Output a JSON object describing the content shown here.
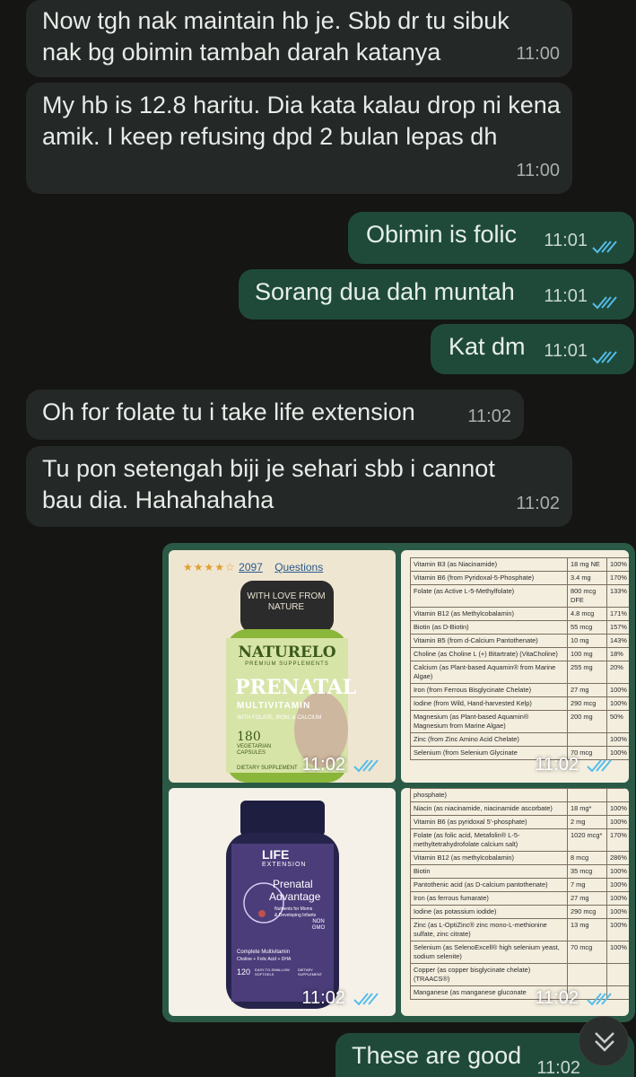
{
  "messages": [
    {
      "text": "Now tgh nak maintain hb je. Sbb dr tu sibuk nak bg obimin tambah darah katanya",
      "time": "11:00"
    },
    {
      "text": "My hb is 12.8 haritu. Dia kata kalau drop ni kena amik. I keep refusing dpd 2 bulan lepas dh",
      "time": "11:00"
    },
    {
      "text": "Obimin is folic",
      "time": "11:01"
    },
    {
      "text": "Sorang dua dah muntah",
      "time": "11:01"
    },
    {
      "text": "Kat dm",
      "time": "11:01"
    },
    {
      "text": "Oh for folate tu i take life extension",
      "time": "11:02"
    },
    {
      "text": "Tu pon setengah biji je sehari sbb i cannot bau dia. Hahahahaha",
      "time": "11:02"
    },
    {
      "text": "These are good",
      "time": "11:02"
    }
  ],
  "album": {
    "images": [
      {
        "time": "11:02",
        "rating_count": "2097",
        "questions": "Questions",
        "brand": "NATURELO",
        "sub": "PREMIUM SUPPLEMENTS",
        "title": "PRENATAL",
        "line2": "MULTIVITAMIN",
        "line3": "WITH FOLATE, IRON, & CALCIUM",
        "count": "180",
        "count_sub": "VEGETARIAN CAPSULES",
        "footer": "DIETARY SUPPLEMENT",
        "cap": "WITH LOVE FROM NATURE"
      },
      {
        "time": "11:02"
      },
      {
        "time": "11:02",
        "brand": "LIFE",
        "brand2": "EXTENSION",
        "title1": "Prenatal",
        "title2": "Advantage",
        "tag1": "Nutrients for Moms",
        "tag2": "& Developing Infants",
        "badge1": "NON",
        "badge2": "GMO",
        "desc1": "Complete Multivitamin",
        "desc2": "Choline + Folic Acid + DHA",
        "count": "120",
        "count_sub": "EASY-TO-SWALLOW SOFTGELS",
        "footer": "DIETARY SUPPLEMENT"
      },
      {
        "time": "11:02"
      }
    ],
    "table1": [
      [
        "Vitamin B3 (as Niacinamide)",
        "18 mg NE",
        "100%"
      ],
      [
        "Vitamin B6 (from Pyridoxal-5-Phosphate)",
        "3.4 mg",
        "170%"
      ],
      [
        "Folate (as Active L-5-Methylfolate)",
        "800 mcg DFE",
        "133%"
      ],
      [
        "Vitamin B12 (as Methylcobalamin)",
        "4.8 mcg",
        "171%"
      ],
      [
        "Biotin (as D-Biotin)",
        "55 mcg",
        "157%"
      ],
      [
        "Vitamin B5 (from d-Calcium Pantothenate)",
        "10 mg",
        "143%"
      ],
      [
        "Choline (as Choline L (+) Bitartrate) (VitaCholine)",
        "100 mg",
        "18%"
      ],
      [
        "Calcium (as Plant-based Aquamin® from Marine Algae)",
        "255 mg",
        "20%"
      ],
      [
        "Iron (from Ferrous Bisglycinate Chelate)",
        "27 mg",
        "100%"
      ],
      [
        "Iodine (from Wild, Hand-harvested Kelp)",
        "290 mcg",
        "100%"
      ],
      [
        "Magnesium (as Plant-based Aquamin® Magnesium from Marine Algae)",
        "200 mg",
        "50%"
      ],
      [
        "Zinc (from Zinc Amino Acid Chelate)",
        "",
        "100%"
      ],
      [
        "Selenium (from Selenium Glycinate",
        "70 mcg",
        "100%"
      ]
    ],
    "table2": [
      [
        "phosphate)",
        "",
        ""
      ],
      [
        "Niacin (as niacinamide, niacinamide ascorbate)",
        "18 mg*",
        "100%"
      ],
      [
        "Vitamin B6 (as pyridoxal 5'-phosphate)",
        "2 mg",
        "100%"
      ],
      [
        "Folate (as folic acid, Metafolin® L-5-methyltetrahydrofolate calcium salt)",
        "1020 mcg*",
        "170%"
      ],
      [
        "Vitamin B12 (as methylcobalamin)",
        "8 mcg",
        "286%"
      ],
      [
        "Biotin",
        "35 mcg",
        "100%"
      ],
      [
        "Pantothenic acid (as D-calcium pantothenate)",
        "7 mg",
        "100%"
      ],
      [
        "Iron (as ferrous fumarate)",
        "27 mg",
        "100%"
      ],
      [
        "Iodine (as potassium iodide)",
        "290 mcg",
        "100%"
      ],
      [
        "Zinc (as L-OptiZinc® zinc mono-L-methionine sulfate, zinc citrate)",
        "13 mg",
        "100%"
      ],
      [
        "Selenium (as SelenoExcell® high selenium yeast, sodium selenite)",
        "70 mcg",
        "100%"
      ],
      [
        "Copper (as copper bisglycinate chelate) (TRAACS®)",
        "",
        ""
      ],
      [
        "Manganese (as manganese gluconate",
        "",
        ""
      ]
    ]
  },
  "colors": {
    "incoming": "#242827",
    "outgoing": "#1f4a3a",
    "tick": "#53bdeb"
  }
}
